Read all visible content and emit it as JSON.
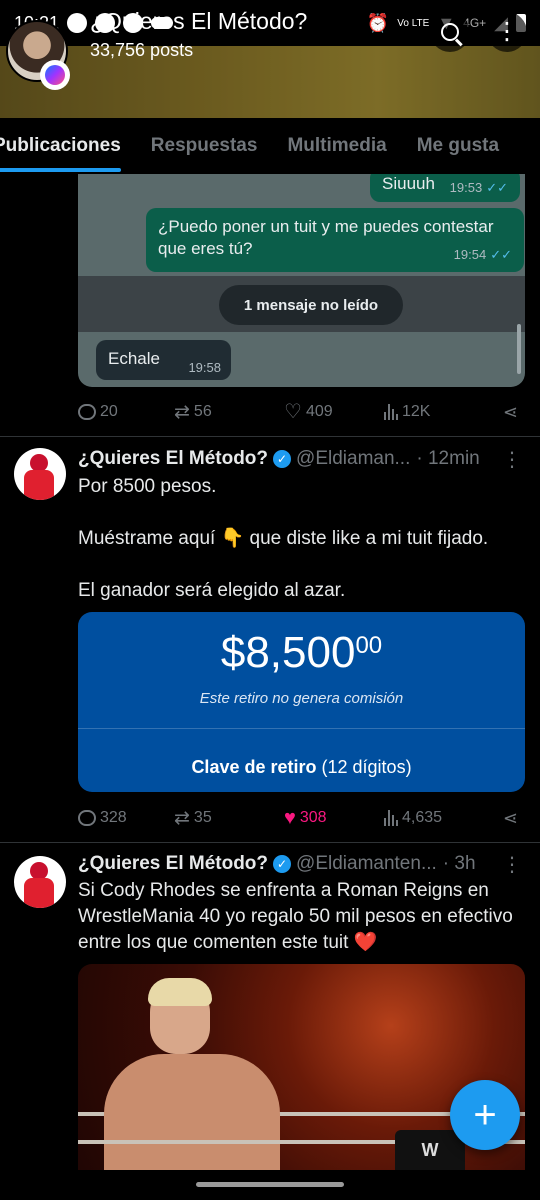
{
  "status_bar": {
    "time": "10:21",
    "network": "4G+"
  },
  "header": {
    "title": "¿Quieres El Método?",
    "posts": "33,756 posts"
  },
  "tabs": [
    {
      "label": "Publicaciones",
      "active": true
    },
    {
      "label": "Respuestas",
      "active": false
    },
    {
      "label": "Multimedia",
      "active": false
    },
    {
      "label": "Me gusta",
      "active": false
    }
  ],
  "chat_image": {
    "bubble_1": {
      "text": "Siuuuh",
      "time": "19:53"
    },
    "bubble_2": {
      "text": "¿Puedo poner un tuit y me puedes contestar que eres tú?",
      "time": "19:54"
    },
    "unread": "1 mensaje no leído",
    "bubble_3": {
      "text": "Echale",
      "time": "19:58"
    }
  },
  "tweet_0_actions": {
    "replies": "20",
    "retweets": "56",
    "likes": "409",
    "views": "12K"
  },
  "tweet_1": {
    "name": "¿Quieres El Método?",
    "handle": "@Eldiaman...",
    "time": "· 12min",
    "text_1": "Por 8500 pesos.",
    "text_2": "Muéstrame aquí 👇 que diste like a mi tuit fijado.",
    "text_3": "El ganador será elegido al azar.",
    "card": {
      "amount": "$8,500",
      "cents": "00",
      "note": "Este retiro no genera comisión",
      "key_bold": "Clave de retiro",
      "key_rest": "(12 dígitos)"
    },
    "actions": {
      "replies": "328",
      "retweets": "35",
      "likes": "308",
      "views": "4,635"
    }
  },
  "tweet_2": {
    "name": "¿Quieres El Método?",
    "handle": "@Eldiamanten...",
    "time": "· 3h",
    "text": "Si Cody Rhodes se enfrenta a Roman Reigns en WrestleMania 40 yo regalo 50 mil pesos en efectivo entre los que comenten este tuit ❤️",
    "photo_logo": "W"
  },
  "colors": {
    "accent": "#1d9bf0",
    "like": "#f91880",
    "card": "#004f9f"
  }
}
